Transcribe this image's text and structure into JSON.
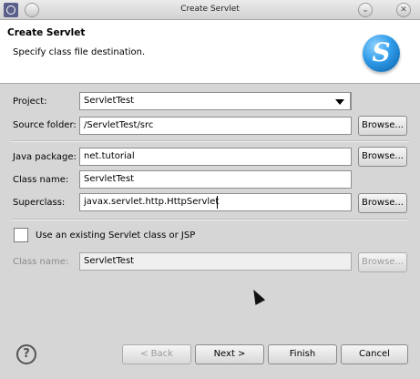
{
  "window": {
    "title": "Create Servlet",
    "minimize_glyph": "⌄",
    "close_glyph": "✕"
  },
  "header": {
    "title": "Create Servlet",
    "description": "Specify class file destination.",
    "logo_letter": "S"
  },
  "form": {
    "project": {
      "label": "Project:",
      "value": "ServletTest"
    },
    "source_folder": {
      "label": "Source folder:",
      "value": "/ServletTest/src",
      "browse": "Browse..."
    },
    "java_package": {
      "label": "Java package:",
      "value": "net.tutorial",
      "browse": "Browse..."
    },
    "class_name": {
      "label": "Class name:",
      "value": "ServletTest"
    },
    "superclass": {
      "label": "Superclass:",
      "value": "javax.servlet.http.HttpServlet",
      "browse": "Browse..."
    },
    "use_existing": {
      "label": "Use an existing Servlet class or JSP",
      "checked": false
    },
    "existing_class_name": {
      "label": "Class name:",
      "value": "ServletTest",
      "browse": "Browse..."
    }
  },
  "footer": {
    "help_glyph": "?",
    "back": "< Back",
    "next": "Next >",
    "finish": "Finish",
    "cancel": "Cancel"
  },
  "icons": {
    "app": "eclipse-app-icon",
    "minimize": "chevron-down-icon",
    "close": "close-icon",
    "logo": "servlet-wizard-logo",
    "help": "help-icon",
    "cursor": "mouse-cursor-icon"
  }
}
